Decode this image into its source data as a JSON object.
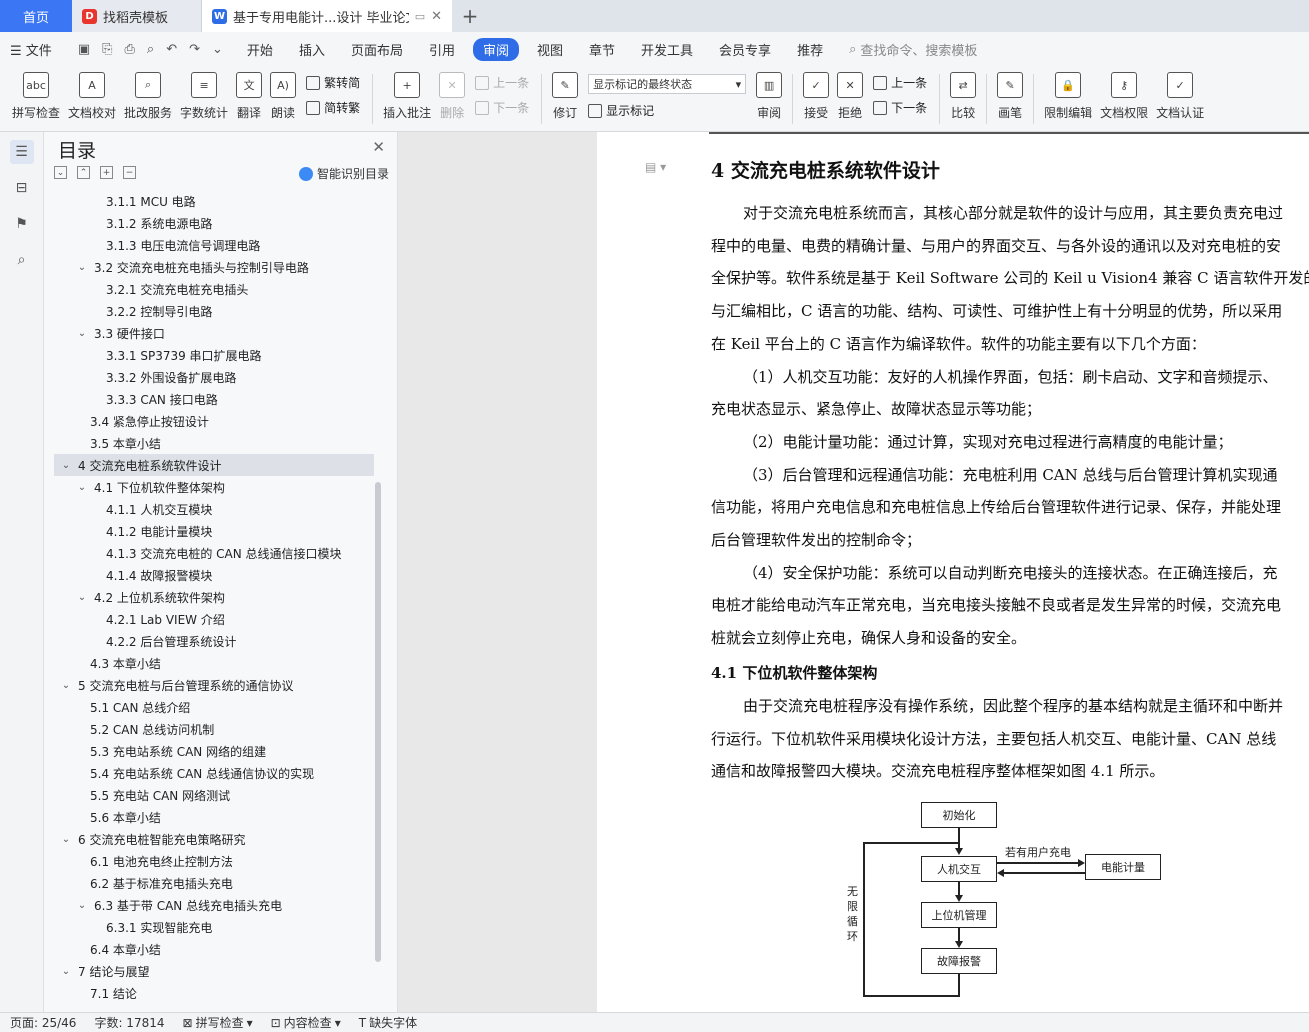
{
  "tabs": {
    "home": "首页",
    "template": "找稻壳模板",
    "document": "基于专用电能计...设计 毕业论文"
  },
  "menu": {
    "file": "文件",
    "items": [
      "开始",
      "插入",
      "页面布局",
      "引用",
      "审阅",
      "视图",
      "章节",
      "开发工具",
      "会员专享",
      "推荐"
    ],
    "active": "审阅",
    "search": "查找命令、搜索模板"
  },
  "ribbon": {
    "spellcheck": "拼写检查",
    "doc_proof": "文档校对",
    "batch_service": "批改服务",
    "word_count": "字数统计",
    "translate": "翻译",
    "read_aloud": "朗读",
    "trad_to_simp": "繁转简",
    "simp_to_trad": "简转繁",
    "insert_comment": "插入批注",
    "delete": "删除",
    "prev": "上一条",
    "next": "下一条",
    "revise": "修订",
    "markup_select": "显示标记的最终状态",
    "show_markup": "显示标记",
    "review": "审阅",
    "accept": "接受",
    "reject": "拒绝",
    "prev2": "上一条",
    "next2": "下一条",
    "compare": "比较",
    "ink": "画笔",
    "restrict_edit": "限制编辑",
    "doc_permission": "文档权限",
    "doc_cert": "文档认证"
  },
  "toc": {
    "title": "目录",
    "smart": "智能识别目录",
    "items": [
      {
        "level": 3,
        "text": "3.1.1 MCU 电路"
      },
      {
        "level": 3,
        "text": "3.1.2  系统电源电路"
      },
      {
        "level": 3,
        "text": "3.1.3 电压电流信号调理电路"
      },
      {
        "level": 2,
        "text": "3.2  交流充电桩充电插头与控制引导电路",
        "chev": true
      },
      {
        "level": 3,
        "text": "3.2.1  交流充电桩充电插头"
      },
      {
        "level": 3,
        "text": "3.2.2  控制导引电路"
      },
      {
        "level": 2,
        "text": "3.3  硬件接口",
        "chev": true
      },
      {
        "level": 3,
        "text": "3.3.1 SP3739 串口扩展电路"
      },
      {
        "level": 3,
        "text": "3.3.2  外围设备扩展电路"
      },
      {
        "level": 3,
        "text": "3.3.3 CAN 接口电路"
      },
      {
        "level": 2,
        "text": "3.4  紧急停止按钮设计"
      },
      {
        "level": 2,
        "text": "3.5  本章小结"
      },
      {
        "level": 1,
        "text": "4  交流充电桩系统软件设计",
        "chev": true,
        "selected": true
      },
      {
        "level": 2,
        "text": "4.1 下位机软件整体架构",
        "chev": true
      },
      {
        "level": 3,
        "text": "4.1.1  人机交互模块"
      },
      {
        "level": 3,
        "text": "4.1.2  电能计量模块"
      },
      {
        "level": 3,
        "text": "4.1.3 交流充电桩的 CAN 总线通信接口模块"
      },
      {
        "level": 3,
        "text": "4.1.4 故障报警模块"
      },
      {
        "level": 2,
        "text": "4.2 上位机系统软件架构",
        "chev": true
      },
      {
        "level": 3,
        "text": "4.2.1 Lab VIEW 介绍"
      },
      {
        "level": 3,
        "text": "4.2.2 后台管理系统设计"
      },
      {
        "level": 2,
        "text": "4.3 本章小结"
      },
      {
        "level": 1,
        "text": "5  交流充电桩与后台管理系统的通信协议",
        "chev": true
      },
      {
        "level": 2,
        "text": "5.1 CAN 总线介绍"
      },
      {
        "level": 2,
        "text": "5.2 CAN 总线访问机制"
      },
      {
        "level": 2,
        "text": "5.3  充电站系统 CAN 网络的组建"
      },
      {
        "level": 2,
        "text": "5.4  充电站系统 CAN 总线通信协议的实现"
      },
      {
        "level": 2,
        "text": "5.5  充电站 CAN 网络测试"
      },
      {
        "level": 2,
        "text": "5.6  本章小结"
      },
      {
        "level": 1,
        "text": "6  交流充电桩智能充电策略研究",
        "chev": true
      },
      {
        "level": 2,
        "text": "6.1  电池充电终止控制方法"
      },
      {
        "level": 2,
        "text": "6.2  基于标准充电插头充电"
      },
      {
        "level": 2,
        "text": "6.3  基于带 CAN 总线充电插头充电",
        "chev": true
      },
      {
        "level": 3,
        "text": "6.3.1 实现智能充电"
      },
      {
        "level": 2,
        "text": "6.4  本章小结"
      },
      {
        "level": 1,
        "text": "7  结论与展望",
        "chev": true
      },
      {
        "level": 2,
        "text": "7.1  结论"
      }
    ]
  },
  "doc": {
    "heading": "4  交流充电桩系统软件设计",
    "lines": [
      "对于交流充电桩系统而言，其核心部分就是软件的设计与应用，其主要负责充电过",
      "程中的电量、电费的精确计量、与用户的界面交互、与各外设的通讯以及对充电桩的安",
      "全保护等。软件系统是基于 Keil Software  公司的 Keil u Vision4 兼容 C 语言软件开发的",
      "与汇编相比，C 语言的功能、结构、可读性、可维护性上有十分明显的优势，所以采用",
      "在 Keil 平台上的 C 语言作为编译软件。软件的功能主要有以下几个方面：",
      "（1）人机交互功能：友好的人机操作界面，包括：刷卡启动、文字和音频提示、",
      "充电状态显示、紧急停止、故障状态显示等功能；",
      "（2）电能计量功能：通过计算，实现对充电过程进行高精度的电能计量；",
      "（3）后台管理和远程通信功能：充电桩利用  CAN  总线与后台管理计算机实现通",
      "信功能，将用户充电信息和充电桩信息上传给后台管理软件进行记录、保存，并能处理",
      "后台管理软件发出的控制命令；",
      "（4）安全保护功能：系统可以自动判断充电接头的连接状态。在正确连接后，充",
      "电桩才能给电动汽车正常充电，当充电接头接触不良或者是发生异常的时候，交流充电",
      "桩就会立刻停止充电，确保人身和设备的安全。"
    ],
    "h2": "4.1 下位机软件整体架构",
    "lines2": [
      "由于交流充电桩程序没有操作系统，因此整个程序的基本结构就是主循环和中断并",
      "行运行。下位机软件采用模块化设计方法，主要包括人机交互、电能计量、CAN 总线",
      "通信和故障报警四大模块。交流充电桩程序整体框架如图 4.1 所示。"
    ],
    "flow": {
      "init": "初始化",
      "hmi": "人机交互",
      "meter": "电能计量",
      "upper": "上位机管理",
      "alarm": "故障报警",
      "if_charge": "若有用户充电",
      "loop": "无限循环"
    }
  },
  "status": {
    "page": "页面: 25/46",
    "words": "字数: 17814",
    "spell": "拼写检查",
    "content": "内容检查",
    "font": "缺失字体"
  }
}
